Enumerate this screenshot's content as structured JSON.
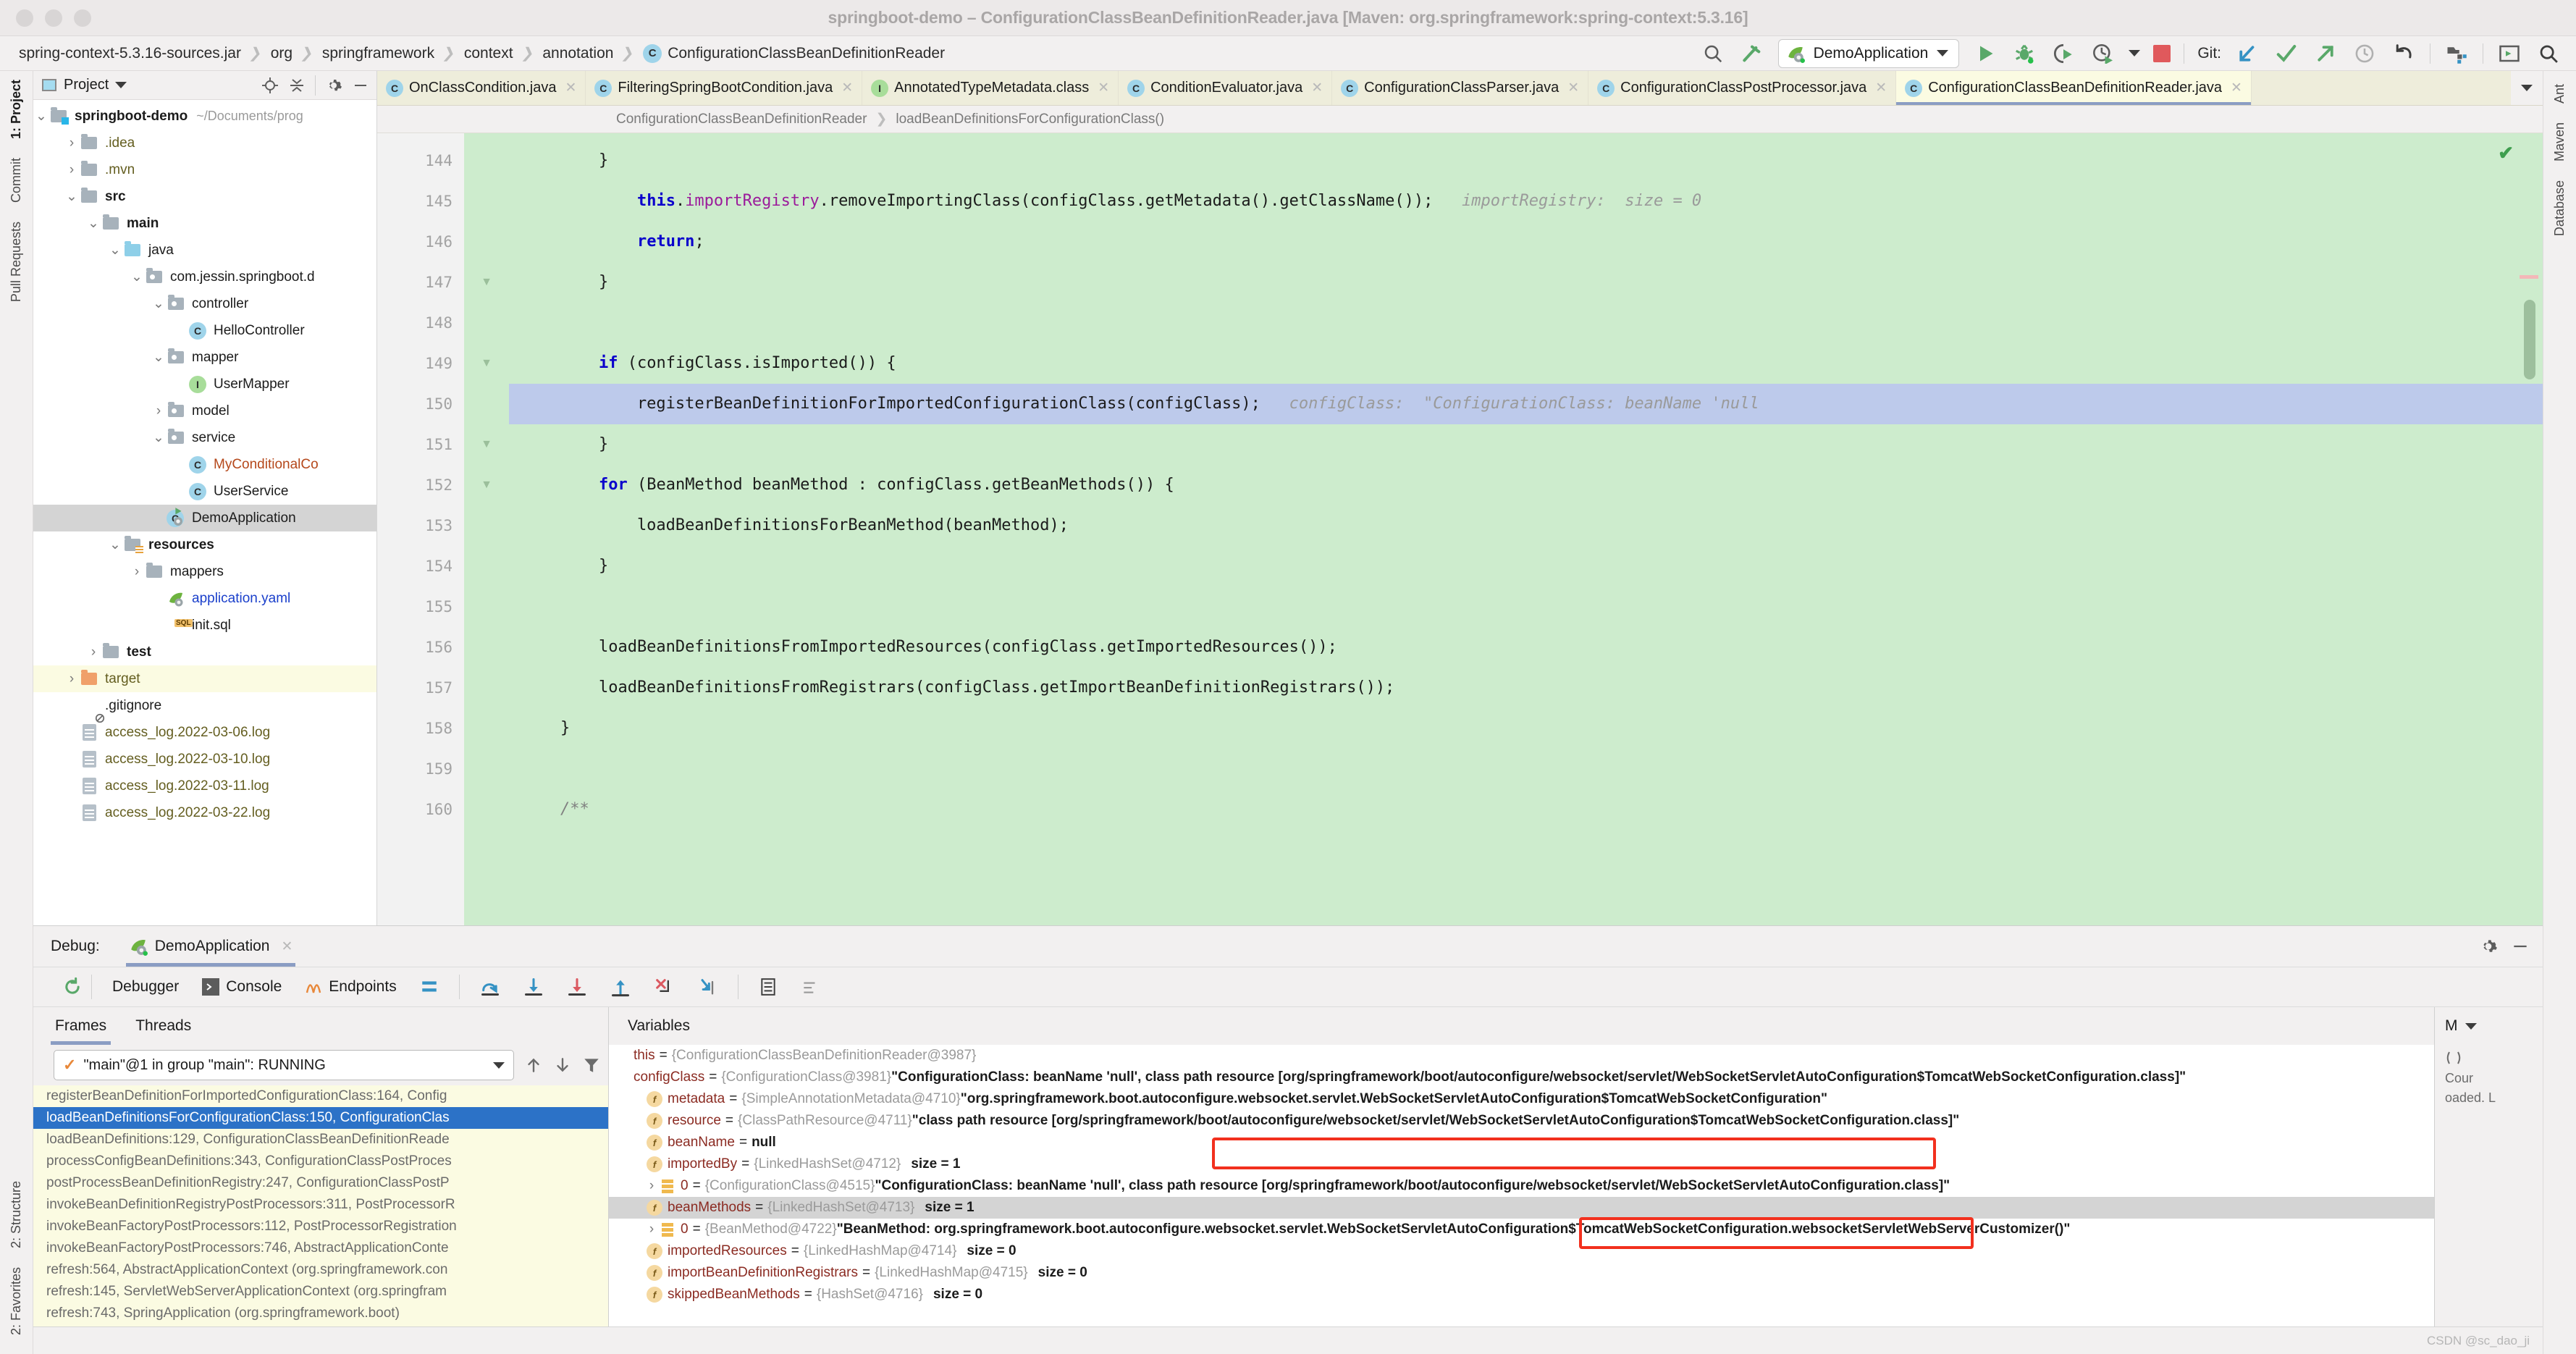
{
  "window": {
    "title": "springboot-demo – ConfigurationClassBeanDefinitionReader.java [Maven: org.springframework:spring-context:5.3.16]"
  },
  "navbar": {
    "crumbs": [
      "spring-context-5.3.16-sources.jar",
      "org",
      "springframework",
      "context",
      "annotation"
    ],
    "current_class": "ConfigurationClassBeanDefinitionReader",
    "class_badge": "C",
    "run_config": "DemoApplication",
    "git_label": "Git:"
  },
  "left_strip": {
    "items": [
      "1: Project",
      "Commit",
      "Pull Requests",
      "2: Structure",
      "2: Favorites"
    ]
  },
  "right_strip": {
    "items": [
      "Ant",
      "Maven",
      "Database"
    ]
  },
  "project": {
    "header_title": "Project",
    "root": "springboot-demo",
    "root_path": "~/Documents/prog",
    "tree": [
      {
        "label": ".idea",
        "depth": 1,
        "arrow": "right",
        "icon": "folder",
        "color": "olive"
      },
      {
        "label": ".mvn",
        "depth": 1,
        "arrow": "right",
        "icon": "folder",
        "color": "olive"
      },
      {
        "label": "src",
        "depth": 1,
        "arrow": "down",
        "icon": "folder",
        "color": "bold"
      },
      {
        "label": "main",
        "depth": 2,
        "arrow": "down",
        "icon": "folder",
        "color": "bold"
      },
      {
        "label": "java",
        "depth": 3,
        "arrow": "down",
        "icon": "folder-blue",
        "color": "plain"
      },
      {
        "label": "com.jessin.springboot.d",
        "depth": 4,
        "arrow": "down",
        "icon": "package",
        "color": "plain"
      },
      {
        "label": "controller",
        "depth": 5,
        "arrow": "down",
        "icon": "package",
        "color": "plain"
      },
      {
        "label": "HelloController",
        "depth": 6,
        "arrow": "none",
        "icon": "class",
        "color": "plain"
      },
      {
        "label": "mapper",
        "depth": 5,
        "arrow": "down",
        "icon": "package",
        "color": "plain"
      },
      {
        "label": "UserMapper",
        "depth": 6,
        "arrow": "none",
        "icon": "interface",
        "color": "plain"
      },
      {
        "label": "model",
        "depth": 5,
        "arrow": "right",
        "icon": "package",
        "color": "plain"
      },
      {
        "label": "service",
        "depth": 5,
        "arrow": "down",
        "icon": "package",
        "color": "plain"
      },
      {
        "label": "MyConditionalCo",
        "depth": 6,
        "arrow": "none",
        "icon": "class",
        "color": "brown"
      },
      {
        "label": "UserService",
        "depth": 6,
        "arrow": "none",
        "icon": "class",
        "color": "plain"
      },
      {
        "label": "DemoApplication",
        "depth": 5,
        "arrow": "none",
        "icon": "spring-class",
        "color": "plain",
        "selected": "grey"
      },
      {
        "label": "resources",
        "depth": 3,
        "arrow": "down",
        "icon": "folder-res",
        "color": "bold"
      },
      {
        "label": "mappers",
        "depth": 4,
        "arrow": "right",
        "icon": "folder",
        "color": "plain"
      },
      {
        "label": "application.yaml",
        "depth": 5,
        "arrow": "none",
        "icon": "spring-file",
        "color": "blue"
      },
      {
        "label": "init.sql",
        "depth": 5,
        "arrow": "none",
        "icon": "sql",
        "color": "plain"
      },
      {
        "label": "test",
        "depth": 2,
        "arrow": "right",
        "icon": "folder",
        "color": "bold"
      },
      {
        "label": "target",
        "depth": 1,
        "arrow": "right",
        "icon": "folder-orange",
        "color": "olive",
        "selected": "yellow"
      },
      {
        "label": ".gitignore",
        "depth": 1,
        "arrow": "none",
        "icon": "ignore",
        "color": "plain"
      },
      {
        "label": "access_log.2022-03-06.log",
        "depth": 1,
        "arrow": "none",
        "icon": "doc",
        "color": "olive"
      },
      {
        "label": "access_log.2022-03-10.log",
        "depth": 1,
        "arrow": "none",
        "icon": "doc",
        "color": "olive"
      },
      {
        "label": "access_log.2022-03-11.log",
        "depth": 1,
        "arrow": "none",
        "icon": "doc",
        "color": "olive"
      },
      {
        "label": "access_log.2022-03-22.log",
        "depth": 1,
        "arrow": "none",
        "icon": "doc",
        "color": "olive"
      }
    ]
  },
  "editor": {
    "tabs": [
      {
        "label": "OnClassCondition.java",
        "badge": "C",
        "badge_kind": "class",
        "active": false
      },
      {
        "label": "FilteringSpringBootCondition.java",
        "badge": "C",
        "badge_kind": "class",
        "active": false
      },
      {
        "label": "AnnotatedTypeMetadata.class",
        "badge": "I",
        "badge_kind": "interface",
        "active": false
      },
      {
        "label": "ConditionEvaluator.java",
        "badge": "C",
        "badge_kind": "class",
        "active": false
      },
      {
        "label": "ConfigurationClassParser.java",
        "badge": "C",
        "badge_kind": "class",
        "active": false
      },
      {
        "label": "ConfigurationClassPostProcessor.java",
        "badge": "C",
        "badge_kind": "class",
        "active": false
      },
      {
        "label": "ConfigurationClassBeanDefinitionReader.java",
        "badge": "C",
        "badge_kind": "class",
        "active": true
      }
    ],
    "breadcrumb": {
      "class": "ConfigurationClassBeanDefinitionReader",
      "method": "loadBeanDefinitionsForConfigurationClass()"
    },
    "lines": [
      {
        "n": "144",
        "segs": [
          {
            "t": "        }",
            "c": "plain"
          }
        ]
      },
      {
        "n": "145",
        "segs": [
          {
            "t": "            ",
            "c": "plain"
          },
          {
            "t": "this",
            "c": "k"
          },
          {
            "t": ".",
            "c": "plain"
          },
          {
            "t": "importRegistry",
            "c": "fld"
          },
          {
            "t": ".removeImportingClass(configClass.getMetadata().getClassName());",
            "c": "plain"
          },
          {
            "t": "   importRegistry:  size = 0",
            "c": "hint"
          }
        ]
      },
      {
        "n": "146",
        "segs": [
          {
            "t": "            ",
            "c": "plain"
          },
          {
            "t": "return",
            "c": "k"
          },
          {
            "t": ";",
            "c": "plain"
          }
        ]
      },
      {
        "n": "147",
        "segs": [
          {
            "t": "        }",
            "c": "plain"
          }
        ]
      },
      {
        "n": "148",
        "segs": [
          {
            "t": "",
            "c": "plain"
          }
        ]
      },
      {
        "n": "149",
        "segs": [
          {
            "t": "        ",
            "c": "plain"
          },
          {
            "t": "if",
            "c": "k"
          },
          {
            "t": " (configClass.isImported()) {",
            "c": "plain"
          }
        ]
      },
      {
        "n": "150",
        "current": true,
        "segs": [
          {
            "t": "            registerBeanDefinitionForImportedConfigurationClass(configClass);",
            "c": "plain"
          },
          {
            "t": "   configClass:  \"ConfigurationClass: beanName 'null",
            "c": "hint"
          }
        ]
      },
      {
        "n": "151",
        "segs": [
          {
            "t": "        }",
            "c": "plain"
          }
        ]
      },
      {
        "n": "152",
        "segs": [
          {
            "t": "        ",
            "c": "plain"
          },
          {
            "t": "for",
            "c": "k"
          },
          {
            "t": " (BeanMethod beanMethod : configClass.getBeanMethods()) {",
            "c": "plain"
          }
        ]
      },
      {
        "n": "153",
        "segs": [
          {
            "t": "            loadBeanDefinitionsForBeanMethod(beanMethod);",
            "c": "plain"
          }
        ]
      },
      {
        "n": "154",
        "segs": [
          {
            "t": "        }",
            "c": "plain"
          }
        ]
      },
      {
        "n": "155",
        "segs": [
          {
            "t": "",
            "c": "plain"
          }
        ]
      },
      {
        "n": "156",
        "segs": [
          {
            "t": "        loadBeanDefinitionsFromImportedResources(configClass.getImportedResources());",
            "c": "plain"
          }
        ]
      },
      {
        "n": "157",
        "segs": [
          {
            "t": "        loadBeanDefinitionsFromRegistrars(configClass.getImportBeanDefinitionRegistrars());",
            "c": "plain"
          }
        ]
      },
      {
        "n": "158",
        "segs": [
          {
            "t": "    }",
            "c": "plain"
          }
        ]
      },
      {
        "n": "159",
        "segs": [
          {
            "t": "",
            "c": "plain"
          }
        ]
      },
      {
        "n": "160",
        "segs": [
          {
            "t": "    /**",
            "c": "cm-blk"
          }
        ]
      }
    ]
  },
  "debug": {
    "panel_label": "Debug:",
    "session_tab": "DemoApplication",
    "toolbar_tabs": [
      "Debugger",
      "Console",
      "Endpoints"
    ],
    "frames_tabs": [
      "Frames",
      "Threads"
    ],
    "thread_selector": "\"main\"@1 in group \"main\": RUNNING",
    "variables_header": "Variables",
    "frames": [
      {
        "text": "registerBeanDefinitionForImportedConfigurationClass:164, Config",
        "selected": false
      },
      {
        "text": "loadBeanDefinitionsForConfigurationClass:150, ConfigurationClas",
        "selected": true
      },
      {
        "text": "loadBeanDefinitions:129, ConfigurationClassBeanDefinitionReade",
        "selected": false
      },
      {
        "text": "processConfigBeanDefinitions:343, ConfigurationClassPostProces",
        "selected": false
      },
      {
        "text": "postProcessBeanDefinitionRegistry:247, ConfigurationClassPostP",
        "selected": false
      },
      {
        "text": "invokeBeanDefinitionRegistryPostProcessors:311, PostProcessorR",
        "selected": false
      },
      {
        "text": "invokeBeanFactoryPostProcessors:112, PostProcessorRegistration",
        "selected": false
      },
      {
        "text": "invokeBeanFactoryPostProcessors:746, AbstractApplicationConte",
        "selected": false
      },
      {
        "text": "refresh:564, AbstractApplicationContext (org.springframework.con",
        "selected": false
      },
      {
        "text": "refresh:145, ServletWebServerApplicationContext (org.springfram",
        "selected": false
      },
      {
        "text": "refresh:743, SpringApplication (org.springframework.boot)",
        "selected": false
      }
    ],
    "variables": [
      {
        "indent": 0,
        "twisty": "",
        "badge": "",
        "name": "this",
        "type": "{ConfigurationClassBeanDefinitionReader@3987}",
        "value": "",
        "size": ""
      },
      {
        "indent": 0,
        "twisty": "",
        "badge": "",
        "name": "configClass",
        "type": "{ConfigurationClass@3981}",
        "value": "\"ConfigurationClass: beanName 'null', class path resource [org/springframework/boot/autoconfigure/websocket/servlet/WebSocketServletAutoConfiguration$TomcatWebSocketConfiguration.class]\"",
        "size": ""
      },
      {
        "indent": 1,
        "twisty": "",
        "badge": "f",
        "name": "metadata",
        "type": "{SimpleAnnotationMetadata@4710}",
        "value": "\"org.springframework.boot.autoconfigure.websocket.servlet.WebSocketServletAutoConfiguration$TomcatWebSocketConfiguration\"",
        "size": ""
      },
      {
        "indent": 1,
        "twisty": "",
        "badge": "f",
        "name": "resource",
        "type": "{ClassPathResource@4711}",
        "value": "\"class path resource [org/springframework/boot/autoconfigure/websocket/servlet/WebSocketServletAutoConfiguration$TomcatWebSocketConfiguration.class]\"",
        "size": ""
      },
      {
        "indent": 1,
        "twisty": "",
        "badge": "f",
        "name": "beanName",
        "type": "",
        "value": "null",
        "size": ""
      },
      {
        "indent": 1,
        "twisty": "",
        "badge": "f",
        "name": "importedBy",
        "type": "{LinkedHashSet@4712}",
        "value": "",
        "size": "size = 1"
      },
      {
        "indent": 2,
        "twisty": "›",
        "badge": "list",
        "name": "0",
        "type": "{ConfigurationClass@4515}",
        "value": "\"ConfigurationClass: beanName 'null', class path resource [org/springframework/boot/autoconfigure/websocket/servlet/WebSocketServletAutoConfiguration.class]\"",
        "size": ""
      },
      {
        "indent": 1,
        "twisty": "",
        "badge": "f",
        "name": "beanMethods",
        "type": "{LinkedHashSet@4713}",
        "value": "",
        "size": "size = 1",
        "highlight": true
      },
      {
        "indent": 2,
        "twisty": "›",
        "badge": "list",
        "name": "0",
        "type": "{BeanMethod@4722}",
        "value": "\"BeanMethod: org.springframework.boot.autoconfigure.websocket.servlet.WebSocketServletAutoConfiguration$TomcatWebSocketConfiguration.websocketServletWebServerCustomizer()\"",
        "size": ""
      },
      {
        "indent": 1,
        "twisty": "",
        "badge": "f",
        "name": "importedResources",
        "type": "{LinkedHashMap@4714}",
        "value": "",
        "size": "size = 0"
      },
      {
        "indent": 1,
        "twisty": "",
        "badge": "f",
        "name": "importBeanDefinitionRegistrars",
        "type": "{LinkedHashMap@4715}",
        "value": "",
        "size": "size = 0"
      },
      {
        "indent": 1,
        "twisty": "",
        "badge": "f",
        "name": "skippedBeanMethods",
        "type": "{HashSet@4716}",
        "value": "",
        "size": "size = 0"
      }
    ],
    "side_panel": {
      "label": "M",
      "col_label": "Cour",
      "loaded_note": "oaded. L"
    }
  },
  "status": {
    "watermark": "CSDN @sc_dao_ji"
  },
  "colors": {
    "accent_blue": "#2c72c7",
    "code_bg_green": "#cdeccd",
    "current_line": "#bdcaeb",
    "tab_active": "#fbfbe2",
    "highlight_red": "#f2301e",
    "keyword": "#0a00cc",
    "field": "#9b1b9b"
  }
}
